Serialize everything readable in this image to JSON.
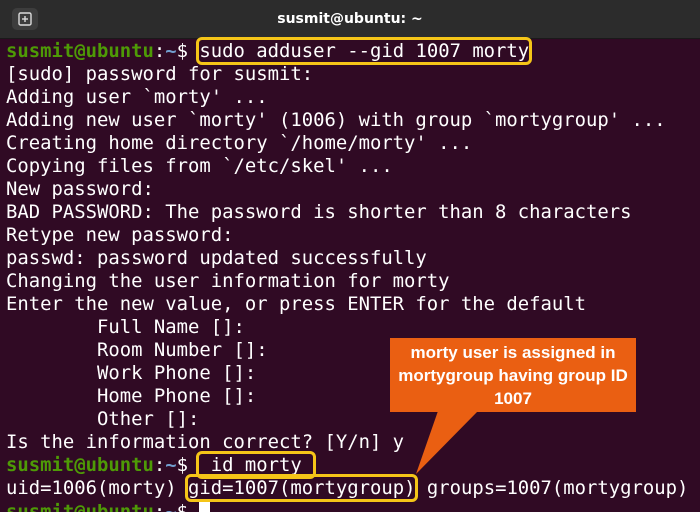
{
  "window": {
    "title": "susmit@ubuntu: ~"
  },
  "terminal": {
    "prompt_user": "susmit@ubuntu",
    "prompt_sep": ":",
    "prompt_path": "~",
    "prompt_dollar": "$ ",
    "cmd1": "sudo adduser --gid 1007 morty",
    "output1": [
      "[sudo] password for susmit:",
      "Adding user `morty' ...",
      "Adding new user `morty' (1006) with group `mortygroup' ...",
      "Creating home directory `/home/morty' ...",
      "Copying files from `/etc/skel' ...",
      "New password:",
      "BAD PASSWORD: The password is shorter than 8 characters",
      "Retype new password:",
      "passwd: password updated successfully",
      "Changing the user information for morty",
      "Enter the new value, or press ENTER for the default",
      "        Full Name []:",
      "        Room Number []:",
      "        Work Phone []:",
      "        Home Phone []:",
      "        Other []:",
      "Is the information correct? [Y/n] y"
    ],
    "cmd2": "id morty",
    "id_output": {
      "uid": "uid=1006(morty) ",
      "gid": "gid=1007(mortygroup)",
      "groups": " groups=1007(mortygroup)"
    }
  },
  "annotation": {
    "text": "morty user is assigned in mortygroup having group ID 1007",
    "color": "#ea5f12",
    "highlight_color": "#f5c518"
  }
}
